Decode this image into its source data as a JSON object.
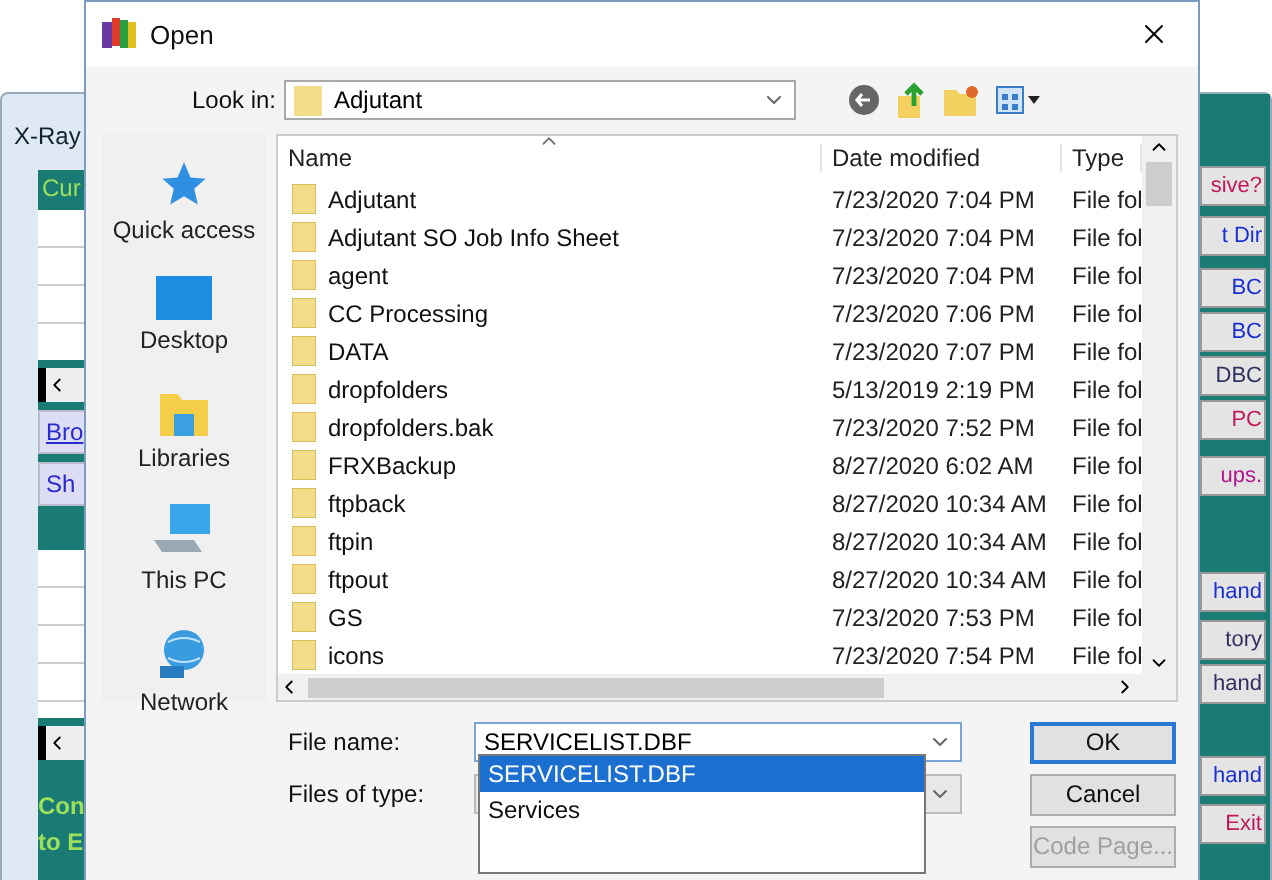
{
  "background_window": {
    "title": "X-Ray",
    "heading": "Cur",
    "left_buttons": [
      "Bro",
      "Sh"
    ],
    "footer": [
      "Con",
      "to E"
    ],
    "right_buttons": [
      {
        "label": "sive?",
        "color": "#c0185a"
      },
      {
        "label": "t Dir",
        "color": "#1a2fd0"
      },
      {
        "label": "BC",
        "color": "#1a2fd0"
      },
      {
        "label": "BC",
        "color": "#1a2fd0"
      },
      {
        "label": "DBC",
        "color": "#303060"
      },
      {
        "label": "PC",
        "color": "#c0185a"
      },
      {
        "label": "ups.",
        "color": "#b01890"
      },
      {
        "label": "hand",
        "color": "#1a2fd0"
      },
      {
        "label": "tory",
        "color": "#303060"
      },
      {
        "label": "hand",
        "color": "#303060"
      },
      {
        "label": "hand",
        "color": "#1a2fd0"
      },
      {
        "label": "Exit",
        "color": "#c0185a"
      }
    ]
  },
  "dialog": {
    "title": "Open",
    "look_in": {
      "label": "Look in:",
      "value": "Adjutant"
    },
    "places": [
      {
        "label": "Quick access",
        "kind": "star"
      },
      {
        "label": "Desktop",
        "kind": "desktop"
      },
      {
        "label": "Libraries",
        "kind": "libraries"
      },
      {
        "label": "This PC",
        "kind": "computer"
      },
      {
        "label": "Network",
        "kind": "network"
      }
    ],
    "columns": [
      "Name",
      "Date modified",
      "Type"
    ],
    "rows": [
      {
        "name": "Adjutant",
        "date": "7/23/2020 7:04 PM",
        "type": "File fol"
      },
      {
        "name": "Adjutant SO Job Info Sheet",
        "date": "7/23/2020 7:04 PM",
        "type": "File fol"
      },
      {
        "name": "agent",
        "date": "7/23/2020 7:04 PM",
        "type": "File fol"
      },
      {
        "name": "CC Processing",
        "date": "7/23/2020 7:06 PM",
        "type": "File fol"
      },
      {
        "name": "DATA",
        "date": "7/23/2020 7:07 PM",
        "type": "File fol"
      },
      {
        "name": "dropfolders",
        "date": "5/13/2019 2:19 PM",
        "type": "File fol"
      },
      {
        "name": "dropfolders.bak",
        "date": "7/23/2020 7:52 PM",
        "type": "File fol"
      },
      {
        "name": "FRXBackup",
        "date": "8/27/2020 6:02 AM",
        "type": "File fol"
      },
      {
        "name": "ftpback",
        "date": "8/27/2020 10:34 AM",
        "type": "File fol"
      },
      {
        "name": "ftpin",
        "date": "8/27/2020 10:34 AM",
        "type": "File fol"
      },
      {
        "name": "ftpout",
        "date": "8/27/2020 10:34 AM",
        "type": "File fol"
      },
      {
        "name": "GS",
        "date": "7/23/2020 7:53 PM",
        "type": "File fol"
      },
      {
        "name": "icons",
        "date": "7/23/2020 7:54 PM",
        "type": "File fol"
      }
    ],
    "file_name": {
      "label": "File name:",
      "value": "SERVICELIST.DBF"
    },
    "autocomplete": [
      {
        "label": "SERVICELIST.DBF",
        "selected": true
      },
      {
        "label": "Services",
        "selected": false
      }
    ],
    "files_of_type": {
      "label": "Files of type:"
    },
    "buttons": [
      {
        "label": "OK",
        "default": true,
        "disabled": false
      },
      {
        "label": "Cancel",
        "default": false,
        "disabled": false
      },
      {
        "label": "Code Page...",
        "default": false,
        "disabled": true
      }
    ]
  }
}
